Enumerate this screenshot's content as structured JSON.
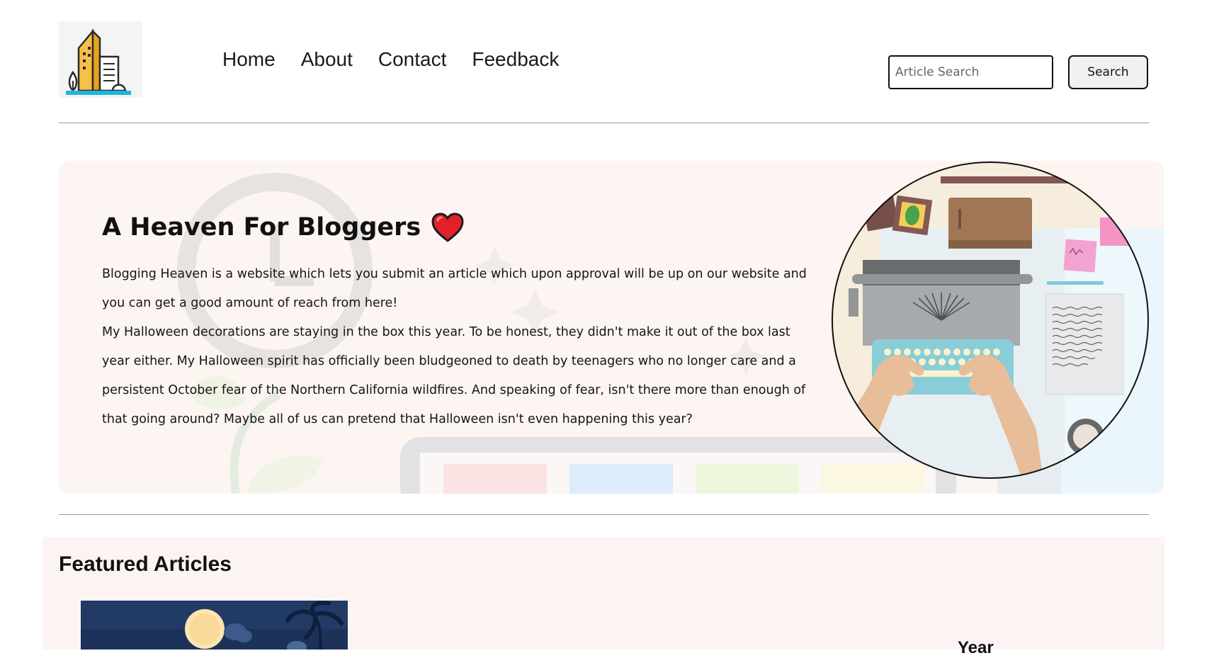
{
  "header": {
    "logo_icon": "city-buildings-logo-icon",
    "nav": [
      "Home",
      "About",
      "Contact",
      "Feedback"
    ],
    "search_placeholder": "Article Search",
    "search_button": "Search"
  },
  "hero": {
    "title": "A Heaven For Bloggers",
    "title_icon": "red-heart-icon",
    "paragraphs": [
      "Blogging Heaven is a website which lets you submit an article which upon approval will be up on our website and you can get a good amount of reach from here!",
      "My Halloween decorations are staying in the box this year. To be honest, they didn't make it out of the box last year either. My Halloween spirit has officially been bludgeoned to death by teenagers who no longer care and a persistent October fear of the Northern California wildfires. And speaking of fear, isn't there more than enough of that going around? Maybe all of us can pretend that Halloween isn't even happening this year?"
    ],
    "image_icon": "typewriter-desk-illustration"
  },
  "featured": {
    "title": "Featured Articles",
    "thumbnail_icon": "night-beach-moon-thumbnail",
    "column_label": "Year"
  },
  "colors": {
    "hero_bg": "#fdf5f1",
    "featured_bg": "#fbf4f2",
    "divider": "#999999",
    "heart": "#e3202a",
    "logo_yellow": "#f6c046",
    "logo_blue": "#1fb6dc"
  }
}
